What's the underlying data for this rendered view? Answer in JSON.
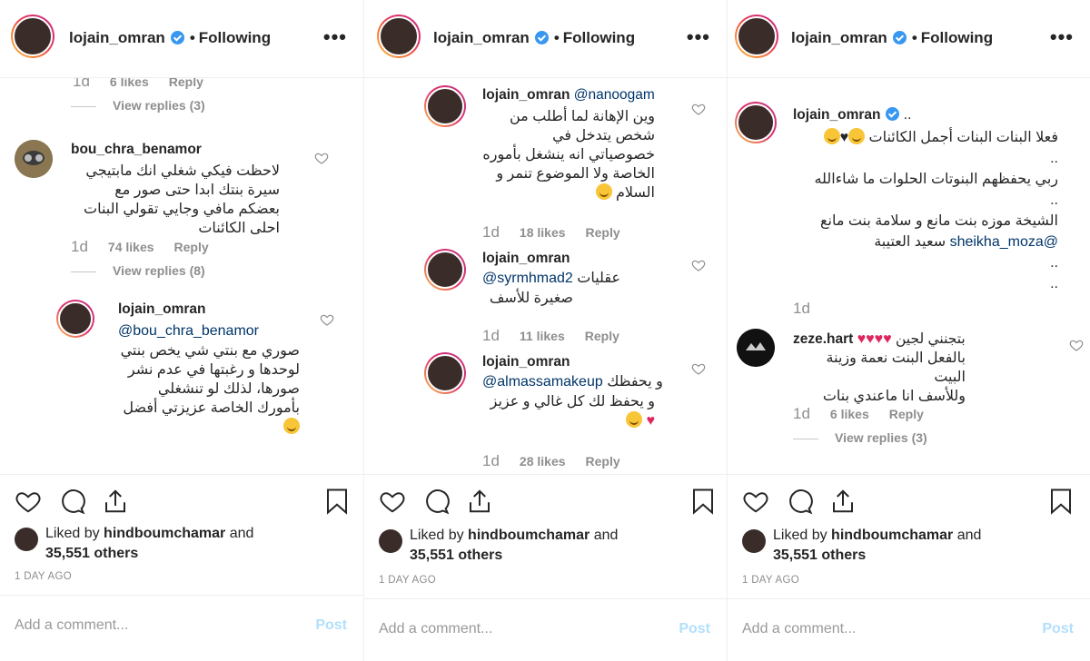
{
  "username": "lojain_omran",
  "following_label": "Following",
  "more_glyph": "•••",
  "dot": "•",
  "liked_by_prefix": "Liked by",
  "liked_by_user": "hindboumchamar",
  "liked_by_suffix": "and",
  "others_count": "35,551 others",
  "time_ago": "1 DAY AGO",
  "add_comment_placeholder": "Add a comment...",
  "post_label": "Post",
  "reply_label": "Reply",
  "panels": [
    {
      "top_meta": {
        "time": "1d",
        "likes": "6 likes"
      },
      "top_view_replies": "View replies (3)",
      "comments": [
        {
          "user": "bou_chra_benamor",
          "text": "لاحظت فيكي شغلي انك مابتيجي سيرة بنتك ابدا حتى صور مع بعضكم مافي وجايي تقولي البنات احلى الكائنات",
          "time": "1d",
          "likes": "74 likes",
          "view_replies": "View replies (8)"
        },
        {
          "user": "lojain_omran",
          "mention": "@bou_chra_benamor",
          "text": "صوري مع بنتي شي يخص بنتي لوحدها و رغبتها في عدم نشر صورها، لذلك لو تنشغلي بأمورك الخاصة عزيزتي أفضل"
        }
      ]
    },
    {
      "comments": [
        {
          "user": "lojain_omran",
          "mention": "@nanoogam",
          "text": "وين الإهانة لما أطلب من شخص يتدخل في خصوصياتي انه ينشغل بأموره الخاصة ولا الموضوع تنمر و السلام",
          "time": "1d",
          "likes": "18 likes"
        },
        {
          "user": "lojain_omran",
          "mention": "@syrmhmad2",
          "text_before": "عقليات",
          "text": "صغيرة للأسف",
          "time": "1d",
          "likes": "11 likes"
        },
        {
          "user": "lojain_omran",
          "mention": "@almassamakeup",
          "text_before": "و يحفظك",
          "text": "و يحفظ لك كل غالي و عزيز",
          "time": "1d",
          "likes": "28 likes"
        }
      ]
    },
    {
      "comments": [
        {
          "user": "lojain_omran",
          "user_suffix": "..",
          "lines": [
            "فعلا البنات البنات أجمل الكائنات",
            "..",
            "ربي يحفظهم البنوتات الحلوات ما شاءالله",
            "..",
            "الشيخة موزه بنت مانع و سلامة بنت مانع",
            "سعيد العتيبة",
            "..",
            ".."
          ],
          "mention": "@sheikha_moza",
          "time": "1d"
        },
        {
          "user": "zeze.hart",
          "text": "بتجنني لجين",
          "lines": [
            "بالفعل البنت نعمة وزينة البيت",
            "وللأسف انا ماعندي بنات"
          ],
          "time": "1d",
          "likes": "6 likes",
          "view_replies": "View replies (3)"
        }
      ]
    }
  ]
}
